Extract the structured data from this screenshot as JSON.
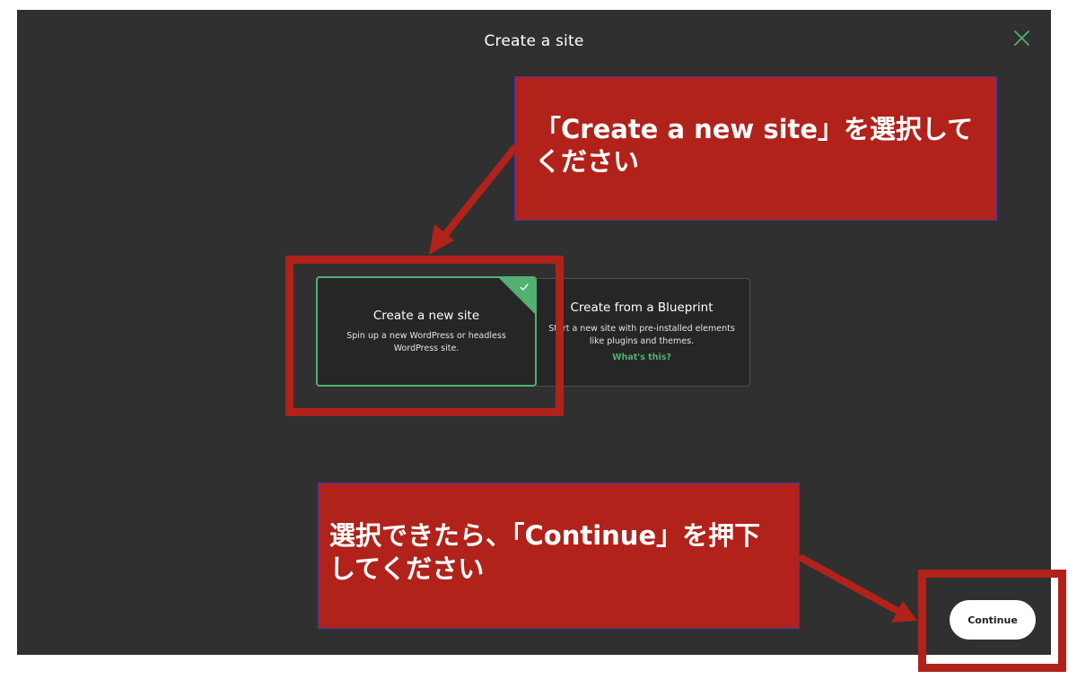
{
  "modal": {
    "title": "Create a site",
    "close_icon": "close-icon"
  },
  "options": {
    "new_site": {
      "title": "Create a new site",
      "description": "Spin up a new WordPress or headless WordPress site.",
      "selected": true
    },
    "blueprint": {
      "title": "Create from a Blueprint",
      "description": "Start a new site with pre-installed elements like plugins and themes.",
      "link": "What's this?"
    }
  },
  "footer": {
    "continue_label": "Continue"
  },
  "annotations": {
    "top_callout": "「Create a new site」を選択してください",
    "bottom_callout": "選択できたら、「Continue」を押下してください"
  },
  "colors": {
    "background": "#303030",
    "card": "#262626",
    "accent_green": "#51b072",
    "annotation_red": "#b0221a"
  }
}
